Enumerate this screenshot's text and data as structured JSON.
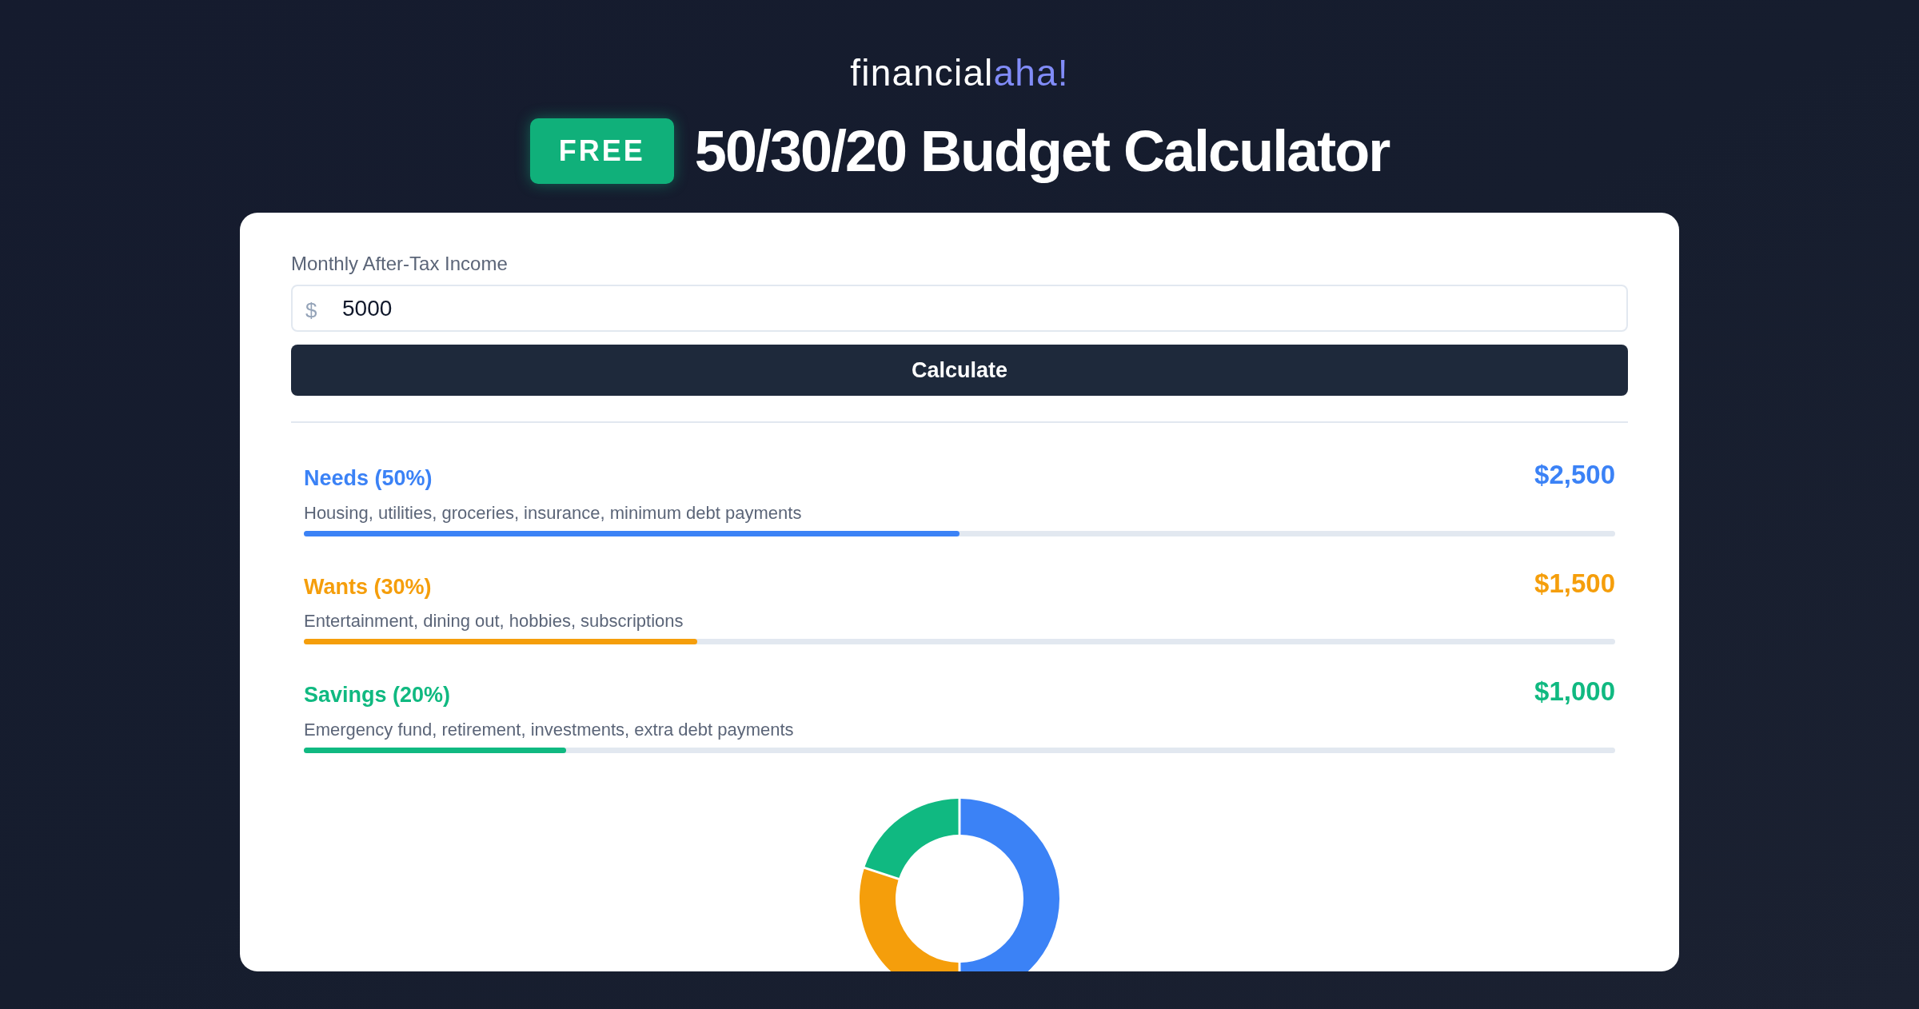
{
  "brand": {
    "name": "financial",
    "accent": "aha!"
  },
  "header": {
    "badge": "FREE",
    "title": "50/30/20 Budget Calculator"
  },
  "income": {
    "label": "Monthly After-Tax Income",
    "prefix": "$",
    "value": "5000"
  },
  "calculate_button": "Calculate",
  "categories": [
    {
      "name": "Needs (50%)",
      "amount": "$2,500",
      "description": "Housing, utilities, groceries, insurance, minimum debt payments",
      "level": 0.5,
      "color": "#3b82f6"
    },
    {
      "name": "Wants (30%)",
      "amount": "$1,500",
      "description": "Entertainment, dining out, hobbies, subscriptions",
      "level": 0.3,
      "color": "#f59e0b"
    },
    {
      "name": "Savings (20%)",
      "amount": "$1,000",
      "description": "Emergency fund, retirement, investments, extra debt payments",
      "level": 0.2,
      "color": "#10b981"
    }
  ]
}
